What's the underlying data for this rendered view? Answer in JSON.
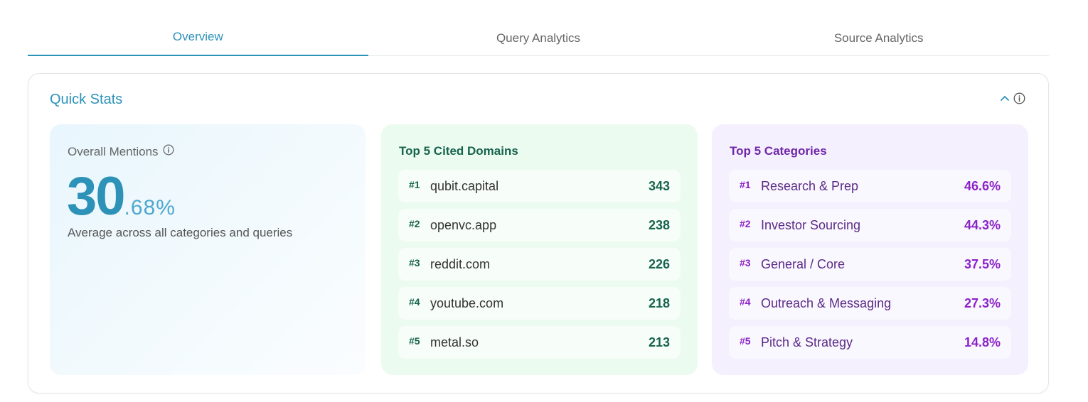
{
  "tabs": [
    {
      "label": "Overview",
      "active": true
    },
    {
      "label": "Query Analytics",
      "active": false
    },
    {
      "label": "Source Analytics",
      "active": false
    }
  ],
  "quick_stats": {
    "title": "Quick Stats",
    "collapse_icon": "chevron-up-icon",
    "info_icon": "info-icon"
  },
  "overall_mentions": {
    "label": "Overall Mentions",
    "value_integer": "30",
    "value_decimal": ".68%",
    "subtitle": "Average across all categories and queries"
  },
  "top_domains": {
    "title": "Top 5 Cited Domains",
    "items": [
      {
        "rank": "#1",
        "name": "qubit.capital",
        "value": "343"
      },
      {
        "rank": "#2",
        "name": "openvc.app",
        "value": "238"
      },
      {
        "rank": "#3",
        "name": "reddit.com",
        "value": "226"
      },
      {
        "rank": "#4",
        "name": "youtube.com",
        "value": "218"
      },
      {
        "rank": "#5",
        "name": "metal.so",
        "value": "213"
      }
    ]
  },
  "top_categories": {
    "title": "Top 5 Categories",
    "items": [
      {
        "rank": "#1",
        "name": "Research & Prep",
        "value": "46.6%"
      },
      {
        "rank": "#2",
        "name": "Investor Sourcing",
        "value": "44.3%"
      },
      {
        "rank": "#3",
        "name": "General / Core",
        "value": "37.5%"
      },
      {
        "rank": "#4",
        "name": "Outreach & Messaging",
        "value": "27.3%"
      },
      {
        "rank": "#5",
        "name": "Pitch & Strategy",
        "value": "14.8%"
      }
    ]
  },
  "colors": {
    "accent": "#2c92b8",
    "domains_green": "#17644f",
    "categories_purple": "#8b22c7"
  }
}
